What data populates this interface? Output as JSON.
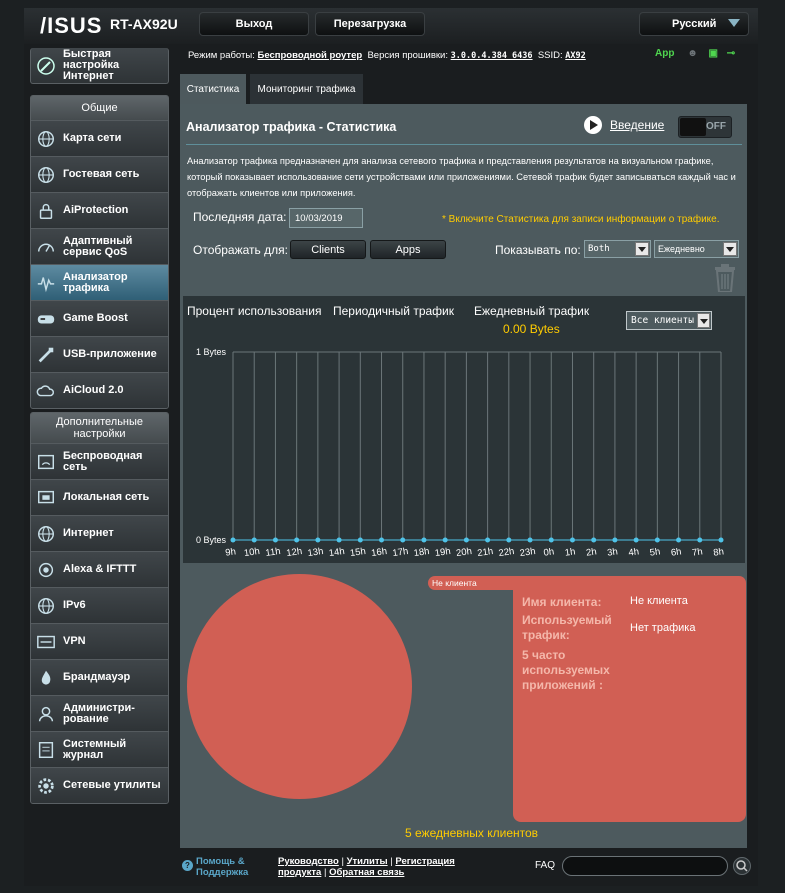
{
  "header": {
    "brand": "/ISUS",
    "model": "RT-AX92U",
    "logout": "Выход",
    "reboot": "Перезагрузка",
    "language": "Русский"
  },
  "sidebar": {
    "quick_setup": "Быстрая настройка Интернет",
    "general_title": "Общие",
    "general_items": [
      {
        "label": "Карта сети",
        "icon": "globe-icon"
      },
      {
        "label": "Гостевая сеть",
        "icon": "globe-icon"
      },
      {
        "label": "AiProtection",
        "icon": "lock-icon"
      },
      {
        "label": "Адаптивный сервис QoS",
        "icon": "speedometer-icon"
      },
      {
        "label": "Анализатор трафика",
        "icon": "waveform-icon",
        "active": true
      },
      {
        "label": "Game Boost",
        "icon": "gamepad-icon"
      },
      {
        "label": "USB-приложение",
        "icon": "usb-icon"
      },
      {
        "label": "AiCloud 2.0",
        "icon": "cloud-icon"
      }
    ],
    "advanced_title": "Дополнительные настройки",
    "advanced_items": [
      {
        "label": "Беспроводная сеть",
        "icon": "wifi-icon"
      },
      {
        "label": "Локальная сеть",
        "icon": "lan-icon"
      },
      {
        "label": "Интернет",
        "icon": "globe-icon"
      },
      {
        "label": "Alexa & IFTTT",
        "icon": "voice-icon"
      },
      {
        "label": "IPv6",
        "icon": "globe-icon"
      },
      {
        "label": "VPN",
        "icon": "vpn-icon"
      },
      {
        "label": "Брандмауэр",
        "icon": "firewall-icon"
      },
      {
        "label": "Администри-рование",
        "icon": "admin-icon"
      },
      {
        "label": "Системный журнал",
        "icon": "log-icon"
      },
      {
        "label": "Сетевые утилиты",
        "icon": "tools-icon"
      }
    ]
  },
  "status": {
    "mode_label": "Режим работы:",
    "mode_value": "Беспроводной роутер",
    "fw_label": "Версия прошивки:",
    "fw_value": "3.0.0.4.384_6436",
    "ssid_label": "SSID:",
    "ssid_value": "AX92",
    "app": "App"
  },
  "tabs": [
    "Статистика",
    "Мониторинг трафика"
  ],
  "page": {
    "title": "Анализатор трафика - Статистика",
    "intro": "Введение",
    "toggle": "OFF",
    "description": "Анализатор трафика предназначен для анализа сетевого трафика и представления результатов на визуальном графике, который показывает использование сети устройствами или приложениями. Сетевой трафик будет записываться каждый час и отображать клиентов или приложения.",
    "last_date_label": "Последняя дата:",
    "last_date": "10/03/2019",
    "note": "* Включите Статистика для записи информации о трафике.",
    "display_for": "Отображать для:",
    "btn_clients": "Clients",
    "btn_apps": "Apps",
    "show_by": "Показывать по:",
    "show_by_value": "Both",
    "period_value": "Ежедневно"
  },
  "chart_tabs": [
    "Процент использования",
    "Периодичный трафик",
    "Ежедневный трафик"
  ],
  "total_bytes": "0.00 Bytes",
  "client_filter": "Все клиенты",
  "chart_data": {
    "type": "line",
    "categories": [
      "9h",
      "10h",
      "11h",
      "12h",
      "13h",
      "14h",
      "15h",
      "16h",
      "17h",
      "18h",
      "19h",
      "20h",
      "21h",
      "22h",
      "23h",
      "0h",
      "1h",
      "2h",
      "3h",
      "4h",
      "5h",
      "6h",
      "7h",
      "8h"
    ],
    "ytick_labels": [
      "0 Bytes",
      "1 Bytes"
    ],
    "ylim": [
      0,
      1
    ],
    "series": [
      {
        "values": [
          0,
          0,
          0,
          0,
          0,
          0,
          0,
          0,
          0,
          0,
          0,
          0,
          0,
          0,
          0,
          0,
          0,
          0,
          0,
          0,
          0,
          0,
          0,
          0
        ]
      }
    ],
    "point_color": "#4fc3e8",
    "grid": true
  },
  "client_panel": {
    "tag": "Не клиента",
    "name_label": "Имя клиента:",
    "name_value": "Не клиента",
    "traffic_label": "Используемый трафик:",
    "traffic_value": "Нет трафика",
    "apps_label": "5 часто используемых приложений :",
    "pie_color": "#d15f54"
  },
  "daily_clients": "5 ежедневных клиентов",
  "footer": {
    "help": "Помощь & Поддержка",
    "links_line1": [
      "Руководство",
      "Утилиты",
      "Регистрация"
    ],
    "links_line2": [
      "продукта",
      "Обратная связь"
    ],
    "faq": "FAQ"
  }
}
